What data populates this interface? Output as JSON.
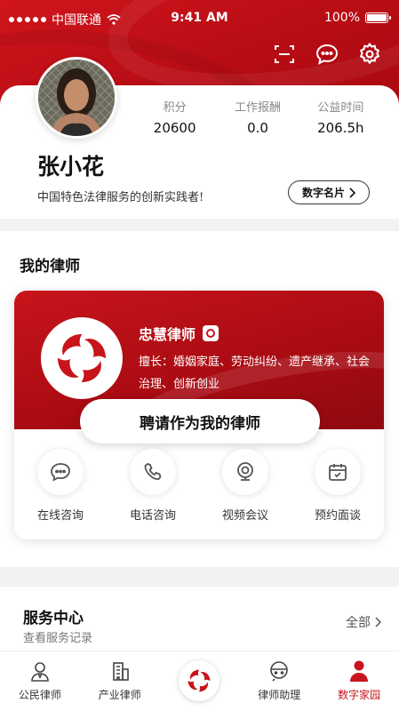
{
  "status_bar": {
    "carrier": "中国联通",
    "time": "9:41 AM",
    "battery": "100%"
  },
  "header_icons": [
    "scan-icon",
    "chat-icon",
    "settings-icon"
  ],
  "profile": {
    "name": "张小花",
    "bio": "中国特色法律服务的创新实践者!",
    "card_button": "数字名片",
    "stats": [
      {
        "label": "积分",
        "value": "20600"
      },
      {
        "label": "工作报酬",
        "value": "0.0"
      },
      {
        "label": "公益时间",
        "value": "206.5h"
      }
    ]
  },
  "my_lawyer": {
    "title": "我的律师",
    "lawyer_name": "忠慧律师",
    "specialty": "擅长：婚姻家庭、劳动纠纷、遗产继承、社会治理、创新创业",
    "hire_button": "聘请作为我的律师",
    "actions": [
      {
        "label": "在线咨询",
        "icon": "chat-bubble-icon"
      },
      {
        "label": "电话咨询",
        "icon": "phone-icon"
      },
      {
        "label": "视频会议",
        "icon": "webcam-icon"
      },
      {
        "label": "预约面谈",
        "icon": "calendar-icon"
      }
    ]
  },
  "service_center": {
    "title": "服务中心",
    "subtitle": "查看服务记录",
    "all_label": "全部"
  },
  "tabbar": [
    {
      "label": "公民律师",
      "icon": "citizen-lawyer-icon"
    },
    {
      "label": "产业律师",
      "icon": "building-icon"
    },
    {
      "label": "",
      "icon": "app-logo-icon"
    },
    {
      "label": "律师助理",
      "icon": "assistant-icon"
    },
    {
      "label": "数字家园",
      "icon": "user-icon",
      "active": true
    }
  ],
  "colors": {
    "brand_red": "#c8141b",
    "text_dark": "#111111",
    "text_muted": "#888888"
  }
}
